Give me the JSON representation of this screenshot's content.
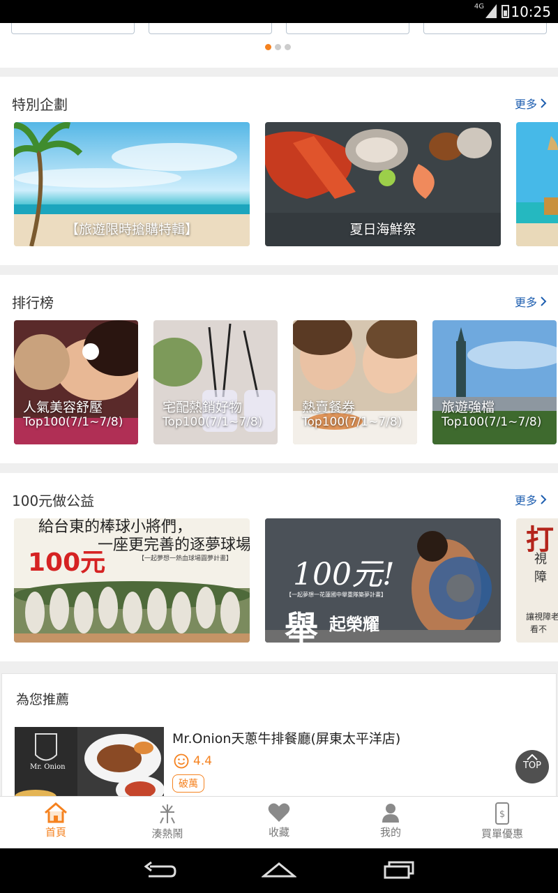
{
  "status_bar": {
    "time": "10:25",
    "network": "4G"
  },
  "carousel": {
    "slides": 3,
    "active": 0
  },
  "special": {
    "title": "特別企劃",
    "more": "更多",
    "banners": [
      {
        "caption": "【旅遊限時搶購特輯】"
      },
      {
        "caption": "夏日海鮮祭"
      }
    ]
  },
  "ranking": {
    "title": "排行榜",
    "more": "更多",
    "tiles": [
      {
        "name": "人氣美容舒壓",
        "period": "Top100(7/1~7/8)"
      },
      {
        "name": "宅配熱銷好物",
        "period": "Top100(7/1~7/8)"
      },
      {
        "name": "熱賣餐券",
        "period": "Top100(7/1~7/8)"
      },
      {
        "name": "旅遊強檔",
        "period": "Top100(7/1~7/8)"
      }
    ]
  },
  "charity": {
    "title": "100元做公益",
    "more": "更多",
    "banners": [
      {
        "line1": "給台東的棒球小將們，",
        "line2": "一座更完善的逐夢球場",
        "amount": "100元",
        "sub": "【一起夢想一熱血球場圓夢計畫】"
      },
      {
        "amount": "100元!",
        "sub": "【一起夢想一花蓮國中舉重隊築夢計畫】",
        "slogan_big": "舉",
        "slogan": "起榮耀"
      },
      {
        "big": "打",
        "line1": "視障",
        "line2": "讓視障老",
        "line3": "看不"
      }
    ]
  },
  "recommend": {
    "title": "為您推薦",
    "item": {
      "name": "Mr.Onion天蔥牛排餐廳(屏東太平洋店)",
      "rating": "4.4",
      "badge": "破萬",
      "logo_text": "Mr. Onion"
    }
  },
  "top_button": {
    "label": "TOP"
  },
  "bottom_nav": [
    {
      "label": "首頁",
      "icon": "home-icon",
      "active": true
    },
    {
      "label": "湊熱鬧",
      "icon": "fireworks-icon",
      "active": false
    },
    {
      "label": "收藏",
      "icon": "heart-icon",
      "active": false
    },
    {
      "label": "我的",
      "icon": "person-icon",
      "active": false
    },
    {
      "label": "買單優惠",
      "icon": "phone-dollar-icon",
      "active": false
    }
  ],
  "colors": {
    "accent": "#f5821f",
    "link": "#1f5fb0"
  }
}
